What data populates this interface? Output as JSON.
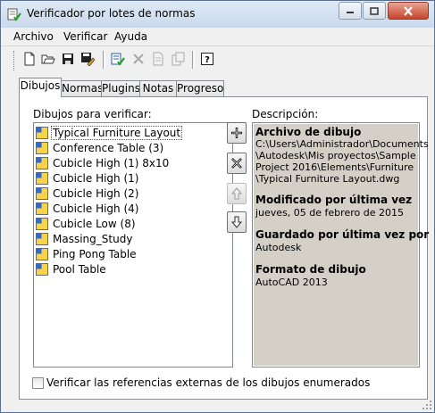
{
  "window": {
    "title": "Verificador por lotes de normas",
    "icon": "checker-app-icon"
  },
  "menu": [
    {
      "label": "Archivo"
    },
    {
      "label": "Verificar"
    },
    {
      "label": "Ayuda"
    }
  ],
  "toolbar": {
    "buttons": [
      "new-icon",
      "open-icon",
      "save-icon",
      "save-as-icon",
      "check-icon",
      "delete-icon",
      "copy-icon",
      "paste-icon",
      "help-icon"
    ],
    "help_glyph": "?"
  },
  "tabs": [
    {
      "label": "Dibujos",
      "active": true
    },
    {
      "label": "Normas"
    },
    {
      "label": "Plugins"
    },
    {
      "label": "Notas"
    },
    {
      "label": "Progreso"
    }
  ],
  "drawings": {
    "list_label": "Dibujos para verificar:",
    "items": [
      "Typical Furniture Layout",
      "Conference Table (3)",
      "Cubicle High (1) 8x10",
      "Cubicle High (1)",
      "Cubicle High (2)",
      "Cubicle High (4)",
      "Cubicle Low (8)",
      "Massing_Study",
      "Ping Pong Table",
      "Pool Table"
    ],
    "selected_index": 0
  },
  "description": {
    "label": "Descripción:",
    "file_heading": "Archivo de dibujo",
    "file_lines": [
      "C:\\Users\\Administrador\\Documents",
      "\\Autodesk\\Mis proyectos\\Sample",
      "Project 2016\\Elements\\Furniture",
      "\\Typical Furniture Layout.dwg"
    ],
    "modified_heading": "Modificado por última vez",
    "modified_value": "jueves, 05 de febrero de 2015",
    "saved_heading": "Guardado por última vez por",
    "saved_value": "Autodesk",
    "format_heading": "Formato de dibujo",
    "format_value": "AutoCAD 2013"
  },
  "xref_check": {
    "label": "Verificar las referencias externas de los dibujos enumerados",
    "checked": false
  },
  "colors": {
    "selection": "#3399ff",
    "desc_bg": "#d4d0c8",
    "title_gradient_top": "#dfe9f5"
  }
}
